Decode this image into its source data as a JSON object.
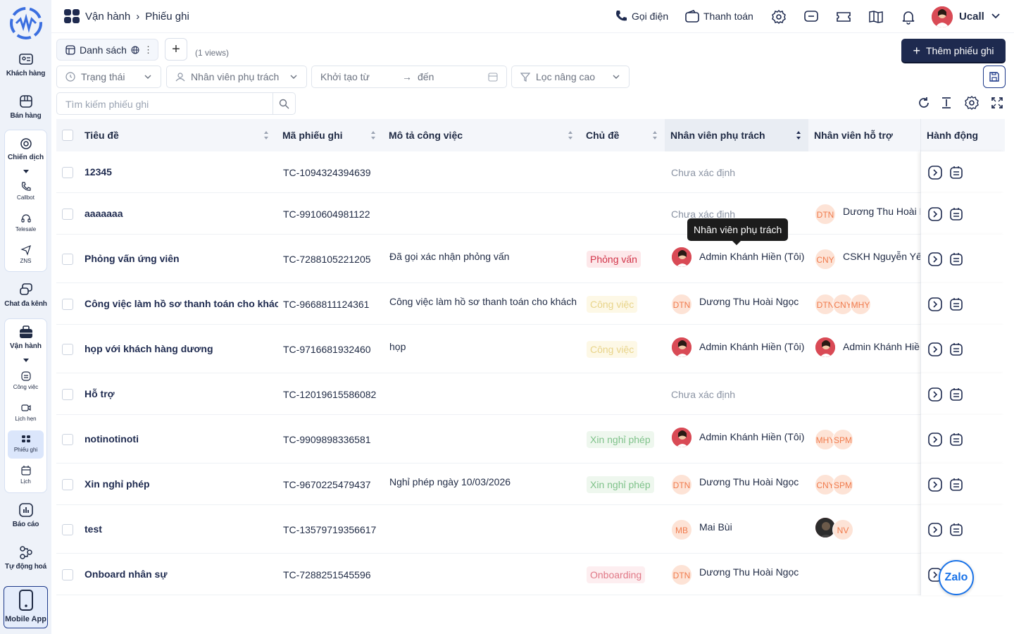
{
  "sidebar": {
    "items": [
      {
        "label": "Khách hàng",
        "icon": "contact-card-icon"
      },
      {
        "label": "Bán hàng",
        "icon": "store-icon"
      },
      {
        "label": "Chiến dịch",
        "icon": "target-icon"
      },
      {
        "label": "Chat đa kênh",
        "icon": "chat-icon"
      },
      {
        "label": "Vận hành",
        "icon": "briefcase-icon"
      },
      {
        "label": "Báo cáo",
        "icon": "chart-icon"
      },
      {
        "label": "Tự động hoá",
        "icon": "automation-icon"
      },
      {
        "label": "Mobile App",
        "icon": "mobile-icon"
      }
    ],
    "campaign_sub": [
      {
        "label": "Callbot",
        "icon": "phone-icon"
      },
      {
        "label": "Telesale",
        "icon": "headset-icon"
      },
      {
        "label": "ZNS",
        "icon": "send-icon"
      }
    ],
    "ops_sub": [
      {
        "label": "Công việc",
        "icon": "task-icon"
      },
      {
        "label": "Lịch hẹn",
        "icon": "video-icon"
      },
      {
        "label": "Phiếu ghi",
        "icon": "ticket-icon"
      },
      {
        "label": "Lịch",
        "icon": "calendar-icon"
      }
    ]
  },
  "header": {
    "breadcrumb": [
      "Vận hành",
      "Phiếu ghi"
    ],
    "call_label": "Gọi điện",
    "payment_label": "Thanh toán",
    "user_name": "Ucall"
  },
  "toolbar": {
    "view_tab_label": "Danh sách",
    "views_count": "(1 views)",
    "add_button_label": "Thêm phiếu ghi",
    "filter_status": "Trạng thái",
    "filter_assignee": "Nhân viên phụ trách",
    "filter_created_from": "Khởi tạo từ",
    "filter_to": "đến",
    "filter_advanced": "Lọc nâng cao",
    "search_placeholder": "Tìm kiếm phiếu ghi"
  },
  "table": {
    "columns": [
      "Tiêu đề",
      "Mã phiếu ghi",
      "Mô tả công việc",
      "Chủ đề",
      "Nhân viên phụ trách",
      "Nhân viên hỗ trợ",
      "Hành động"
    ],
    "rows": [
      {
        "title": "12345",
        "code": "TC-1094324394639",
        "desc": "",
        "topic": "",
        "assignee": "Chưa xác định",
        "assignee_type": "none",
        "support": "",
        "support_avatars": []
      },
      {
        "title": "aaaaaaa",
        "code": "TC-9910604981122",
        "desc": "",
        "topic": "",
        "assignee": "Chưa xác định",
        "assignee_type": "none",
        "support": "Dương Thu Hoài Ngọc",
        "support_avatars": [
          "DTN"
        ]
      },
      {
        "title": "Phỏng vấn ứng viên",
        "code": "TC-7288105221205",
        "desc": "Đã gọi xác nhận phỏng vấn",
        "topic": "Phỏng vấn",
        "assignee": "Admin Khánh Hiền (Tôi)",
        "assignee_type": "photo",
        "support": "CSKH Nguyễn Yến",
        "support_avatars": [
          "CNY"
        ]
      },
      {
        "title": "Công việc làm hồ sơ thanh toán cho khách",
        "code": "TC-9668811124361",
        "desc": "Công việc làm hồ sơ thanh toán cho khách",
        "topic": "Công việc",
        "assignee": "Dương Thu Hoài Ngọc",
        "assignee_type": "DTN",
        "support": "",
        "support_avatars": [
          "DTN",
          "CNY",
          "MHY"
        ]
      },
      {
        "title": "họp với khách hàng dương",
        "code": "TC-9716681932460",
        "desc": "họp",
        "topic": "Công việc",
        "assignee": "Admin Khánh Hiền (Tôi)",
        "assignee_type": "photo",
        "support": "Admin Khánh Hiền",
        "support_avatars": [
          "photo"
        ]
      },
      {
        "title": "Hỗ trợ",
        "code": "TC-12019615586082",
        "desc": "",
        "topic": "",
        "assignee": "Chưa xác định",
        "assignee_type": "none",
        "support": "",
        "support_avatars": []
      },
      {
        "title": "notinotinoti",
        "code": "TC-9909898336581",
        "desc": "",
        "topic": "Xin nghỉ phép",
        "assignee": "Admin Khánh Hiền (Tôi)",
        "assignee_type": "photo",
        "support": "",
        "support_avatars": [
          "MHY",
          "SPM"
        ]
      },
      {
        "title": "Xin nghỉ phép",
        "code": "TC-9670225479437",
        "desc": "Nghỉ phép ngày 10/03/2026",
        "topic": "Xin nghỉ phép",
        "assignee": "Dương Thu Hoài Ngọc",
        "assignee_type": "DTN",
        "support": "",
        "support_avatars": [
          "CNY",
          "SPM"
        ]
      },
      {
        "title": "test",
        "code": "TC-13579719356617",
        "desc": "",
        "topic": "",
        "assignee": "Mai Bùi",
        "assignee_type": "MB",
        "support": "",
        "support_avatars": [
          "photo2",
          "NV"
        ]
      },
      {
        "title": "Onboard nhân sự",
        "code": "TC-7288251545596",
        "desc": "",
        "topic": "Onboarding",
        "assignee": "Dương Thu Hoài Ngọc",
        "assignee_type": "DTN",
        "support": "",
        "support_avatars": []
      }
    ]
  },
  "tooltip": "Nhân viên phụ trách",
  "zalo_label": "Zalo",
  "colors": {
    "brand": "#1e2a4f",
    "accent": "#1e3a8a",
    "avatar_bg": "#fde3d6",
    "avatar_fg": "#f07b4d"
  }
}
